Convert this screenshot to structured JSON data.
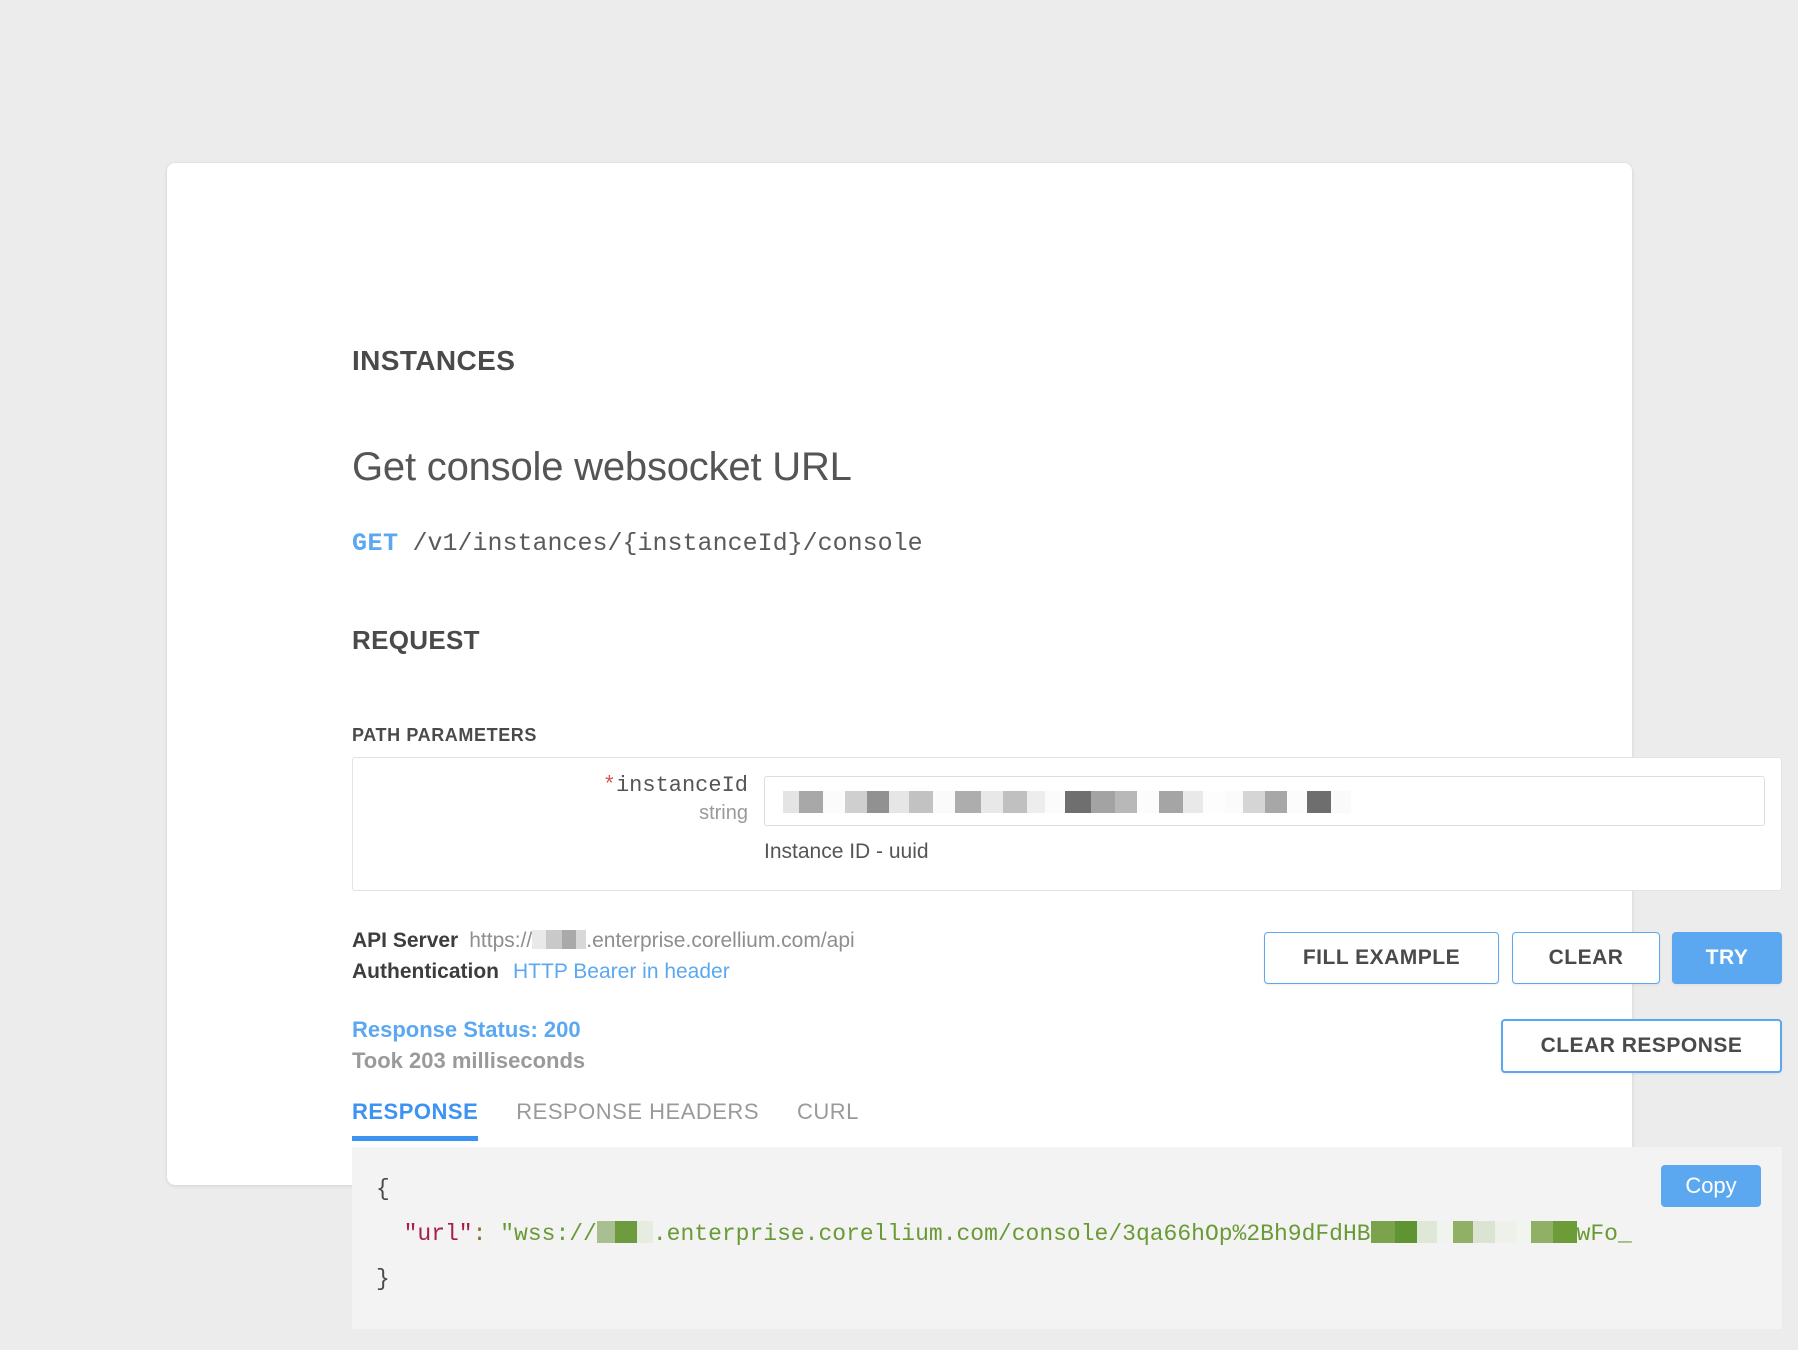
{
  "card": {
    "section_tag": "INSTANCES",
    "title": "Get console websocket URL",
    "endpoint": {
      "method": "GET",
      "path": "/v1/instances/{instanceId}/console"
    },
    "request_heading": "REQUEST"
  },
  "path_parameters": {
    "label": "PATH PARAMETERS",
    "rows": [
      {
        "required_marker": "*",
        "name": "instanceId",
        "type": "string",
        "value": "",
        "value_redacted": true,
        "help": "Instance ID - uuid"
      }
    ]
  },
  "meta": {
    "api_server_label": "API Server",
    "api_server_prefix": "https://",
    "api_server_suffix": ".enterprise.corellium.com/api",
    "api_server_host_redacted": true,
    "authentication_label": "Authentication",
    "authentication_value": "HTTP Bearer in header"
  },
  "actions": {
    "fill_example": "FILL EXAMPLE",
    "clear": "CLEAR",
    "try": "TRY",
    "clear_response": "CLEAR RESPONSE"
  },
  "response": {
    "status_text": "Response Status: 200",
    "status_code": 200,
    "timing_text": "Took 203 milliseconds",
    "timing_ms": 203,
    "tabs": [
      {
        "label": "RESPONSE",
        "active": true
      },
      {
        "label": "RESPONSE HEADERS",
        "active": false
      },
      {
        "label": "CURL",
        "active": false
      }
    ],
    "copy_label": "Copy",
    "body": {
      "open_brace": "{",
      "close_brace": "}",
      "key": "\"url\"",
      "colon": ":",
      "value_prefix": "\"wss://",
      "value_mid": ".enterprise.corellium.com/console/3qa66hOp%2Bh9dFdHB",
      "value_tail": "wFo_",
      "value_redacted": true
    }
  },
  "colors": {
    "page_background": "#ececec",
    "card_background": "#ffffff",
    "accent_blue": "#5ca8f0",
    "tab_active_blue": "#3d93f2",
    "required_red": "#d9534f",
    "json_key": "#a61e4d",
    "json_string": "#6a9a35",
    "muted_text": "#9a9a9a",
    "heading_text": "#4a4a4a",
    "response_panel": "#f3f3f3"
  }
}
